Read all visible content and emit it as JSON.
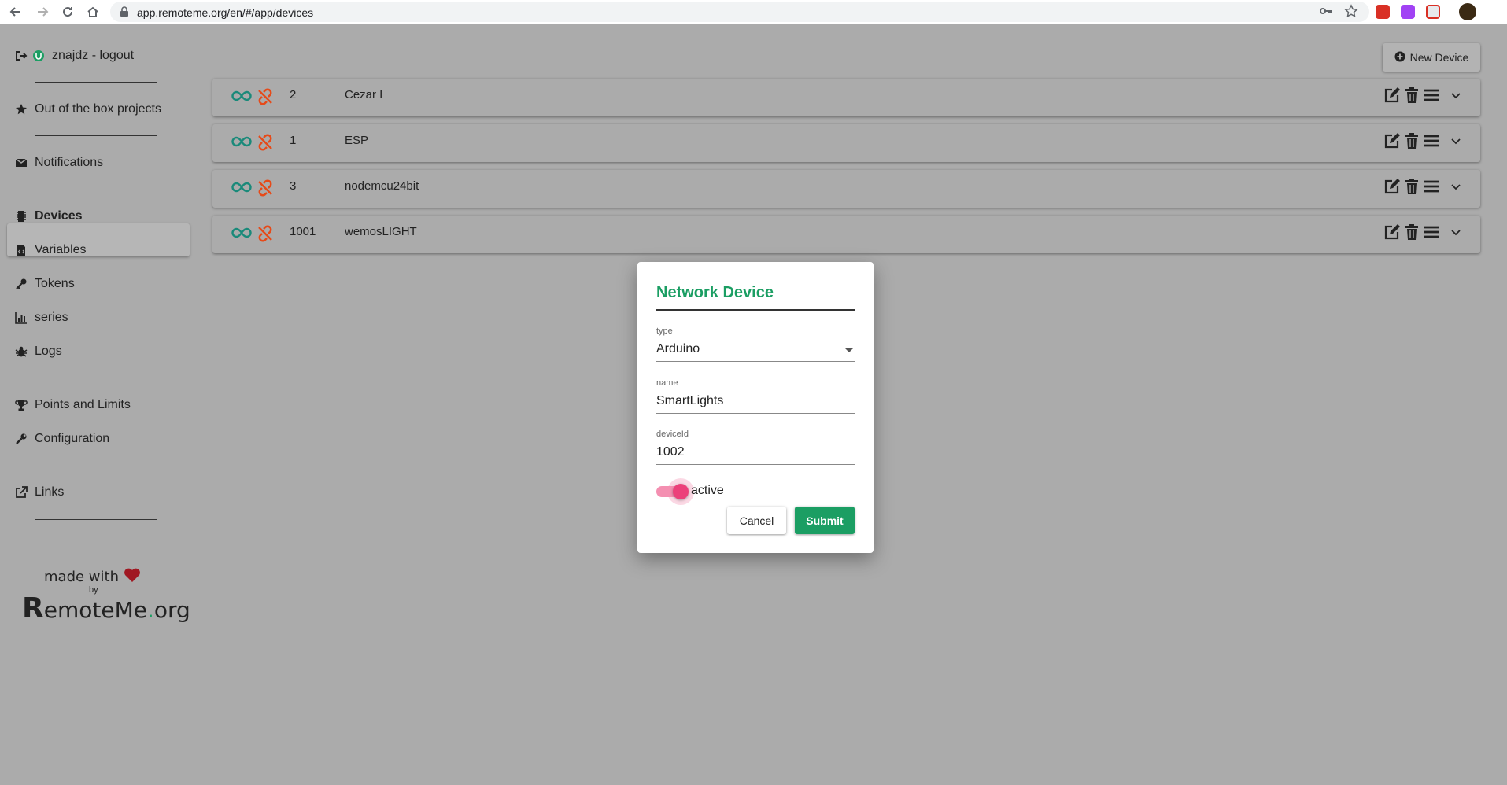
{
  "browser": {
    "url": "app.remoteme.org/en/#/app/devices"
  },
  "sidebar": {
    "user": "znajdz - logout",
    "items": [
      {
        "label": "Out of the box projects",
        "icon": "star-icon"
      },
      {
        "label": "Notifications",
        "icon": "envelope-icon"
      },
      {
        "label": "Devices",
        "icon": "chip-icon"
      },
      {
        "label": "Variables",
        "icon": "file-code-icon"
      },
      {
        "label": "Tokens",
        "icon": "key-icon"
      },
      {
        "label": "series",
        "icon": "bar-chart-icon"
      },
      {
        "label": "Logs",
        "icon": "bug-icon"
      },
      {
        "label": "Points and Limits",
        "icon": "trophy-icon"
      },
      {
        "label": "Configuration",
        "icon": "wrench-icon"
      },
      {
        "label": "Links",
        "icon": "external-link-icon"
      }
    ],
    "footer": {
      "made_with": "made with",
      "by": "by",
      "logo_r": "R",
      "logo_rest": "emoteMe",
      "logo_dot": ".",
      "logo_tld": "org"
    }
  },
  "main": {
    "new_device_label": "New Device",
    "devices": [
      {
        "id": "2",
        "name": "Cezar I"
      },
      {
        "id": "1",
        "name": "ESP"
      },
      {
        "id": "3",
        "name": "nodemcu24bit"
      },
      {
        "id": "1001",
        "name": "wemosLIGHT"
      }
    ]
  },
  "modal": {
    "title": "Network Device",
    "type_label": "type",
    "type_value": "Arduino",
    "name_label": "name",
    "name_value": "SmartLights",
    "deviceid_label": "deviceId",
    "deviceid_value": "1002",
    "active_label": "active",
    "active": true,
    "cancel_label": "Cancel",
    "submit_label": "Submit"
  },
  "colors": {
    "accent": "#1b9e63",
    "toggle": "#ec407a",
    "disconnected": "#e64a19",
    "connected_icon": "#1a8a7a"
  }
}
